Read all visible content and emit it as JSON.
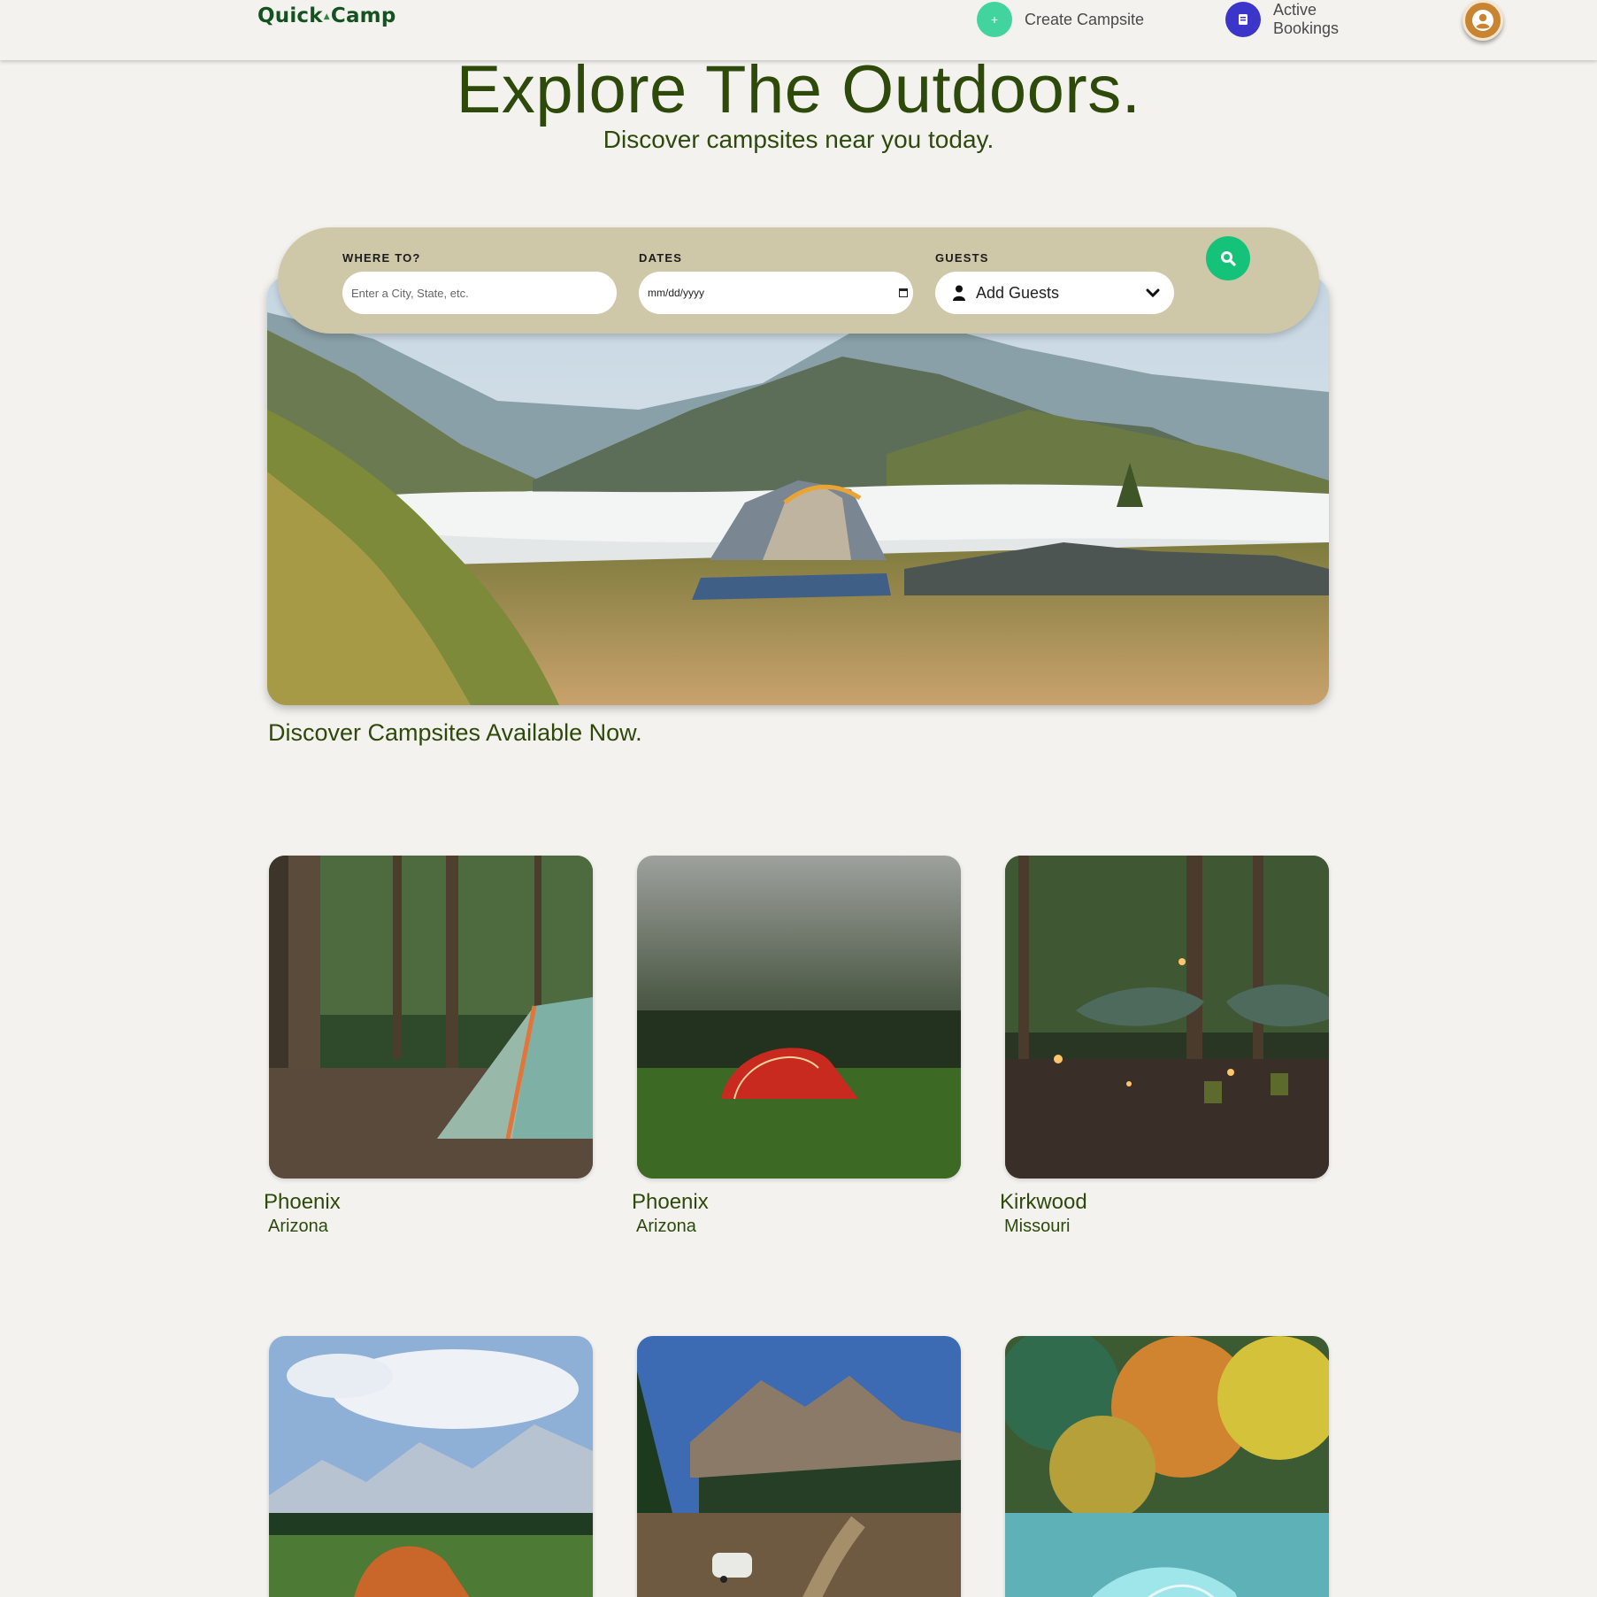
{
  "header": {
    "logo": {
      "left": "Quick",
      "right": "Camp"
    },
    "create_label": "Create Campsite",
    "bookings_label": "Active Bookings"
  },
  "hero": {
    "title": "Explore The Outdoors.",
    "subtitle": "Discover campsites near you today."
  },
  "search": {
    "where_label": "WHERE TO?",
    "where_placeholder": "Enter a City, State, etc.",
    "dates_label": "DATES",
    "dates_value": "mm/dd/yyyy",
    "guests_label": "GUESTS",
    "guests_value": "Add Guests"
  },
  "section_title": "Discover Campsites Available Now.",
  "campsites": [
    {
      "city": "Phoenix",
      "state": "Arizona"
    },
    {
      "city": "Phoenix",
      "state": "Arizona"
    },
    {
      "city": "Kirkwood",
      "state": "Missouri"
    },
    {
      "city": "",
      "state": ""
    },
    {
      "city": "",
      "state": ""
    },
    {
      "city": "",
      "state": ""
    }
  ],
  "colors": {
    "page_bg": "#f3f2ef",
    "brand_text": "#2d4a0b",
    "search_bar": "#cfc8a8",
    "search_button": "#15c27a",
    "create_button": "#42d49f",
    "bookings_button": "#3b35c9",
    "avatar": "#c98431"
  },
  "icons": {
    "create": "plus-icon",
    "bookings": "book-icon",
    "avatar": "user-circle-icon",
    "guests": "person-icon",
    "dropdown": "chevron-down-icon",
    "search": "search-icon",
    "dates": "calendar-icon"
  }
}
